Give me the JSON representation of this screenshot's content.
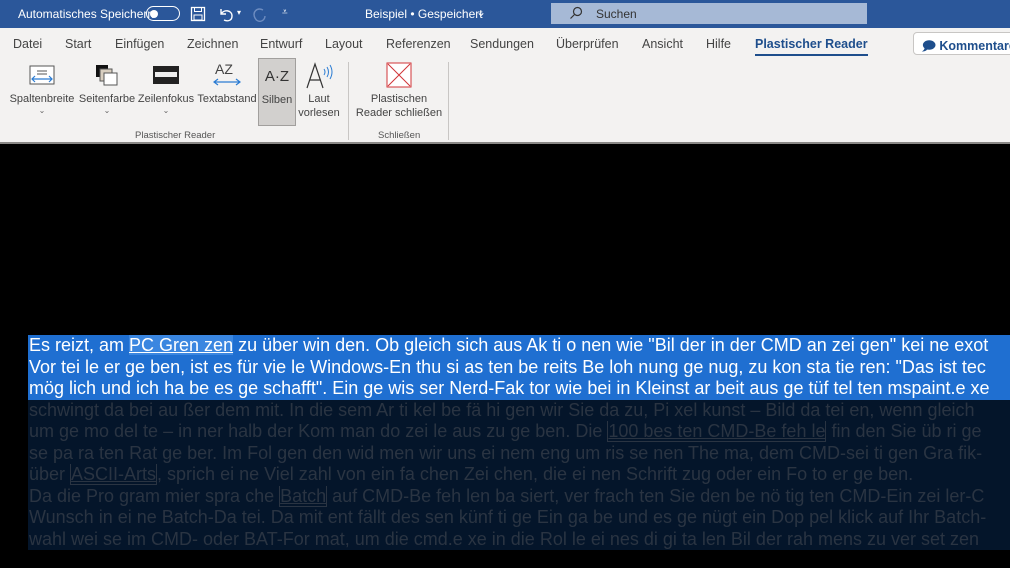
{
  "titlebar": {
    "autosave_label": "Automatisches Speichern",
    "autosave_on": false,
    "doc_title": "Beispiel • Gespeichert",
    "search_placeholder": "Suchen"
  },
  "tabs": [
    {
      "label": "Datei"
    },
    {
      "label": "Start"
    },
    {
      "label": "Einfügen"
    },
    {
      "label": "Zeichnen"
    },
    {
      "label": "Entwurf"
    },
    {
      "label": "Layout"
    },
    {
      "label": "Referenzen"
    },
    {
      "label": "Sendungen"
    },
    {
      "label": "Überprüfen"
    },
    {
      "label": "Ansicht"
    },
    {
      "label": "Hilfe"
    },
    {
      "label": "Plastischer Reader",
      "active": true
    }
  ],
  "comments_label": "Kommentare",
  "ribbon": {
    "buttons": [
      {
        "label": "Spaltenbreite"
      },
      {
        "label": "Seitenfarbe"
      },
      {
        "label": "Zeilenfokus"
      },
      {
        "label": "Textabstand"
      },
      {
        "label": "Silben",
        "selected": true
      },
      {
        "label": "Laut",
        "label2": "vorlesen"
      },
      {
        "label": "Plastischen",
        "label2": "Reader schließen"
      }
    ],
    "group1": "Plastischer Reader",
    "group2": "Schließen"
  },
  "document": {
    "lines": [
      {
        "focus": true,
        "parts": [
          "Es reizt, am ",
          {
            "link": "PC Gren zen"
          },
          " zu über win den. Ob gleich sich aus Ak ti o nen wie \"Bil der in der CMD an zei gen\" kei ne exot"
        ]
      },
      {
        "focus": true,
        "parts": [
          "Vor tei le er ge ben, ist es für vie le Windows-En thu si as ten be reits Be loh nung ge nug, zu kon sta tie ren: \"Das ist tec"
        ]
      },
      {
        "focus": true,
        "parts": [
          "mög lich und ich ha be es ge schafft\". Ein ge wis ser Nerd-Fak tor wie bei in Kleinst ar beit aus ge tüf tel ten mspaint.e xe"
        ]
      },
      {
        "focus": false,
        "parts": [
          "schwingt da bei au ßer dem mit. In die sem Ar ti kel be fä hi gen wir Sie da zu, Pi xel kunst – Bild da tei en, wenn gleich"
        ]
      },
      {
        "focus": false,
        "parts": [
          "um ge mo del te – in ner halb der Kom man do zei le aus zu ge ben. Die ",
          {
            "link": "100 bes ten CMD-Be feh le"
          },
          " fin den Sie üb ri ge"
        ]
      },
      {
        "focus": false,
        "parts": [
          "se pa ra ten Rat ge ber. Im Fol gen den wid men wir uns ei nem eng um ris se nen The ma, dem CMD-sei ti gen Gra fik-"
        ]
      },
      {
        "focus": false,
        "parts": [
          "über ",
          {
            "link": "ASCII-Arts"
          },
          ", sprich ei ne Viel zahl von ein fa chen Zei chen, die ei nen Schrift zug oder ein Fo to er ge ben."
        ]
      },
      {
        "focus": false,
        "parts": [
          "Da die Pro gram mier spra che ",
          {
            "link": "Batch"
          },
          " auf CMD-Be feh len ba siert, ver frach ten Sie den be nö tig ten CMD-Ein zei ler-C"
        ]
      },
      {
        "focus": false,
        "parts": [
          "Wunsch in ei ne Batch-Da tei. Da mit ent fällt des sen künf ti ge Ein ga be und es ge nügt ein Dop pel klick auf Ihr Batch-"
        ]
      },
      {
        "focus": false,
        "parts": [
          "wahl wei se im CMD- oder BAT-For mat, um die cmd.e xe in die Rol le ei nes di gi ta len Bil der rah mens zu ver set zen"
        ]
      }
    ]
  }
}
